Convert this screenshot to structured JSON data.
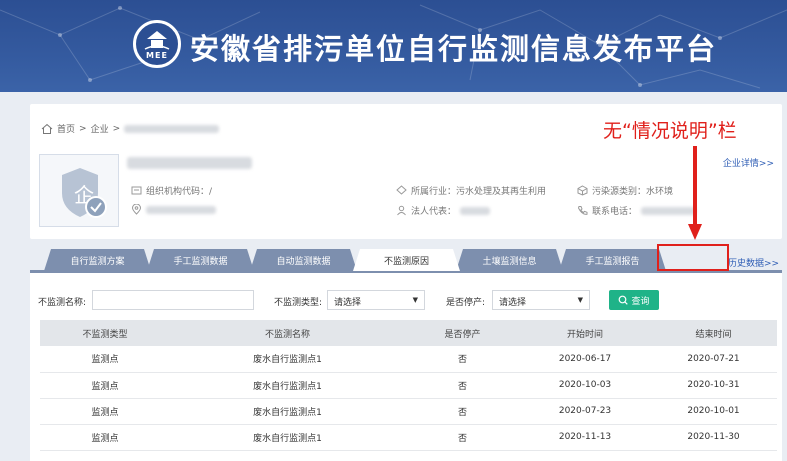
{
  "header": {
    "logo_text": "MEE",
    "title": "安徽省排污单位自行监测信息发布平台"
  },
  "annotation": "无“情况说明”栏",
  "breadcrumb": {
    "home": "首页",
    "sep1": ">",
    "enterprise": "企业",
    "sep2": ">"
  },
  "company": {
    "detail_link": "企业详情>>",
    "org_code_label": "组织机构代码：/",
    "industry_label": "所属行业：污水处理及其再生利用",
    "legal_rep_label": "法人代表：",
    "pollution_type_label": "污染源类别：水环境",
    "phone_label": "联系电话："
  },
  "tabs": [
    {
      "label": "自行监测方案",
      "active": false
    },
    {
      "label": "手工监测数据",
      "active": false
    },
    {
      "label": "自动监测数据",
      "active": false
    },
    {
      "label": "不监测原因",
      "active": true
    },
    {
      "label": "土壤监测信息",
      "active": false
    },
    {
      "label": "手工监测报告",
      "active": false
    }
  ],
  "history_link": "历史数据>>",
  "filters": {
    "name_label": "不监测名称:",
    "type_label": "不监测类型:",
    "type_value": "请选择",
    "stop_label": "是否停产:",
    "stop_value": "请选择",
    "query_label": "查询"
  },
  "table": {
    "headers": [
      "不监测类型",
      "不监测名称",
      "是否停产",
      "开始时间",
      "结束时间"
    ],
    "rows": [
      [
        "监测点",
        "废水自行监测点1",
        "否",
        "2020-06-17",
        "2020-07-21"
      ],
      [
        "监测点",
        "废水自行监测点1",
        "否",
        "2020-10-03",
        "2020-10-31"
      ],
      [
        "监测点",
        "废水自行监测点1",
        "否",
        "2020-07-23",
        "2020-10-01"
      ],
      [
        "监测点",
        "废水自行监测点1",
        "否",
        "2020-11-13",
        "2020-11-30"
      ]
    ]
  },
  "colors": {
    "header_bg": "#2c4f93",
    "tab_bg": "#7d8fae",
    "query_btn": "#1fb388",
    "annotation": "#e0201b",
    "link": "#2f5eb5"
  }
}
